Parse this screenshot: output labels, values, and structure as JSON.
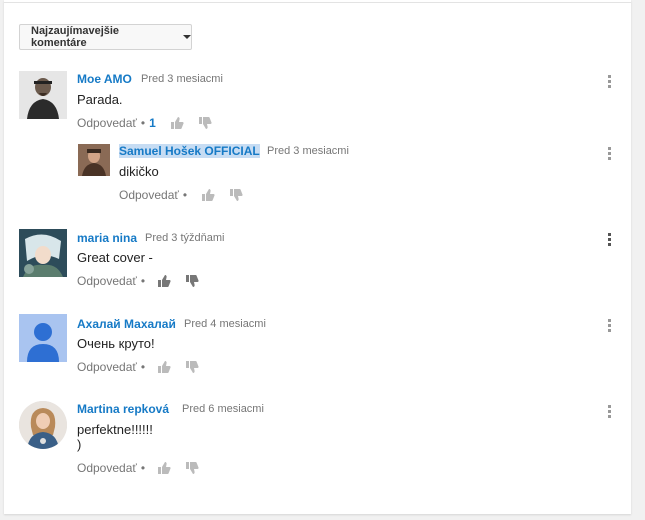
{
  "sort": {
    "label": "Najzaujímavejšie komentáre"
  },
  "colors": {
    "link": "#167ac6",
    "muted": "#767676",
    "highlight": "#c6dcf3"
  },
  "comments": [
    {
      "author": "Moe AMO",
      "time": "Pred 3 mesiacmi",
      "text": "Parada.",
      "reply_label": "Odpovedať",
      "reply_count": "1",
      "avatar_icon": "man-with-beard-photo"
    },
    {
      "author": "Samuel Hošek OFFICIAL",
      "time": "Pred 3 mesiacmi",
      "text": "dikičko",
      "reply_label": "Odpovedať",
      "avatar_icon": "musician-photo"
    },
    {
      "author": "maria nina",
      "time": "Pred 3 týždňami",
      "text": "Great cover -",
      "reply_label": "Odpovedať",
      "avatar_icon": "anime-character-photo"
    },
    {
      "author": "Ахалай Махалай",
      "time": "Pred 4 mesiacmi",
      "text": "Очень круто!",
      "reply_label": "Odpovedať",
      "avatar_icon": "default-user-avatar"
    },
    {
      "author": "Martina repková",
      "time": "Pred 6 mesiacmi",
      "text": "perfektne!!!!!!\n)",
      "reply_label": "Odpovedať",
      "avatar_icon": "woman-photo"
    }
  ]
}
